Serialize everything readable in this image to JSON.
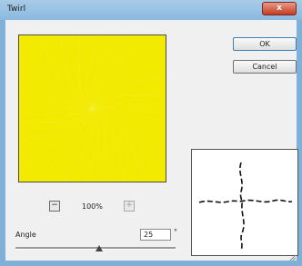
{
  "window": {
    "title": "Twirl",
    "close_label": "x"
  },
  "preview": {
    "zoom_value": "100%",
    "zoom_out_icon": "minus-icon",
    "zoom_in_icon": "plus-icon"
  },
  "buttons": {
    "ok_label": "OK",
    "cancel_label": "Cancel"
  },
  "angle": {
    "label": "Angle",
    "value": "25",
    "unit": "°",
    "slider_fraction": 0.52
  },
  "colors": {
    "rays": "#f2ea00",
    "background": "#ffffff",
    "accent": "#3c7fb1"
  }
}
